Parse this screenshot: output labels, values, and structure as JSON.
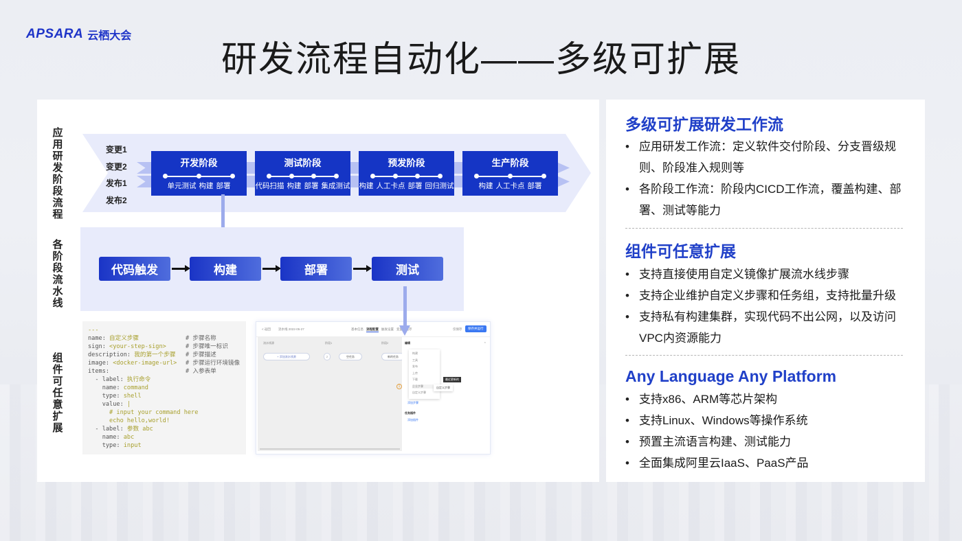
{
  "brand": {
    "logo_text": "APSARA",
    "logo_cn": "云栖大会",
    "accent": "#1e34c8"
  },
  "title": "研发流程自动化——多级可扩展",
  "diagram": {
    "row_labels": {
      "stage_flow": "应用研发阶段流程",
      "pipeline": "各阶段流水线",
      "component": "组件可任意扩展"
    },
    "branches": [
      "变更1",
      "变更2",
      "发布1",
      "发布2"
    ],
    "stages": [
      {
        "title": "开发阶段",
        "steps": [
          "单元测试",
          "构建",
          "部署"
        ]
      },
      {
        "title": "测试阶段",
        "steps": [
          "代码扫描",
          "构建",
          "部署",
          "集成测试"
        ]
      },
      {
        "title": "预发阶段",
        "steps": [
          "构建",
          "人工卡点",
          "部署",
          "回归测试"
        ]
      },
      {
        "title": "生产阶段",
        "steps": [
          "构建",
          "人工卡点",
          "部署"
        ]
      }
    ],
    "pipeline_steps": [
      "代码触发",
      "构建",
      "部署",
      "测试"
    ],
    "stage_color": "#1535c5",
    "code_lines": [
      {
        "text": "---",
        "comment": ""
      },
      {
        "key": "name: ",
        "val": "自定义步骤",
        "comment": "# 步骤名称"
      },
      {
        "key": "sign: ",
        "val": "<your-step-sign>",
        "comment": "# 步骤唯一标识"
      },
      {
        "key": "description: ",
        "val": "我的第一个步骤",
        "comment": "# 步骤描述"
      },
      {
        "key": "image: ",
        "val": "<docker-image-url>",
        "comment": "# 步骤运行环境镜像"
      },
      {
        "key": "items:",
        "val": "",
        "comment": "# 入参表单"
      },
      {
        "key": "  - label: ",
        "val": "执行命令",
        "comment": ""
      },
      {
        "key": "    name: ",
        "val": "command",
        "comment": ""
      },
      {
        "key": "    type: ",
        "val": "shell",
        "comment": ""
      },
      {
        "key": "    value: ",
        "val": "|",
        "comment": ""
      },
      {
        "key": "      ",
        "val": "# input your command here",
        "comment": ""
      },
      {
        "key": "      ",
        "val": "echo hello,world!",
        "comment": ""
      },
      {
        "key": "  - label: ",
        "val": "参数 abc",
        "comment": ""
      },
      {
        "key": "    name: ",
        "val": "abc",
        "comment": ""
      },
      {
        "key": "    type: ",
        "val": "input",
        "comment": ""
      }
    ],
    "screenshot": {
      "back": "< 返回",
      "pipeline_name": "流水线 2022-05-27",
      "tabs": [
        "基本信息",
        "流程配置",
        "触发设置",
        "变量和缓存"
      ],
      "save_label": "仅保存",
      "run_label": "保存并运行",
      "col_labels": [
        "流水线源",
        "阶段1",
        "阶段2"
      ],
      "add_source": "+ 添加流水线源",
      "empty_task": "空任务",
      "new_task": "新的任务",
      "side_title": "编辑",
      "menu_items": [
        "构建",
        "工具",
        "发布",
        "上传",
        "下载",
        "企业步骤",
        "自定义步骤"
      ],
      "tooltip": "最近更新的",
      "submenu_item": "自定义步骤",
      "add_step": "添加步骤",
      "task_plugin": "任务插件",
      "add_plugin": "添加插件"
    }
  },
  "right": {
    "sections": [
      {
        "title": "多级可扩展研发工作流",
        "bullets": [
          "应用研发工作流：定义软件交付阶段、分支晋级规则、阶段准入规则等",
          "各阶段工作流：阶段内CICD工作流，覆盖构建、部署、测试等能力"
        ]
      },
      {
        "title": "组件可任意扩展",
        "bullets": [
          "支持直接使用自定义镜像扩展流水线步骤",
          "支持企业维护自定义步骤和任务组，支持批量升级",
          "支持私有构建集群，实现代码不出公网，以及访问VPC内资源能力"
        ]
      },
      {
        "title": "Any Language Any Platform",
        "bullets": [
          "支持x86、ARM等芯片架构",
          "支持Linux、Windows等操作系统",
          "预置主流语言构建、测试能力",
          "全面集成阿里云IaaS、PaaS产品"
        ]
      }
    ],
    "title_color": "#2040c8"
  }
}
